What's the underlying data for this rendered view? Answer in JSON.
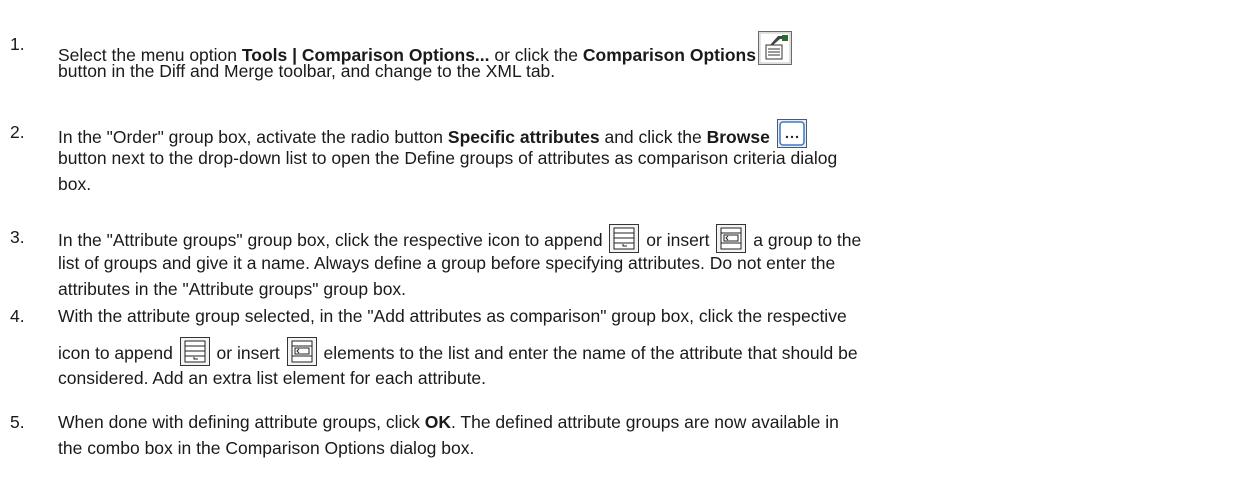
{
  "steps": [
    {
      "number": "1.",
      "l1_a": "Select the menu option ",
      "l1_b": "Tools | Comparison Options...",
      "l1_c": " or click the ",
      "l1_d": "Comparison Options",
      "l2": " button in the Diff and Merge toolbar, and change to the XML tab.",
      "icon": "comparison-options-icon"
    },
    {
      "number": "2.",
      "l1_a": "In the \"Order\" group box, activate the radio button ",
      "l1_b": "Specific attributes",
      "l1_c": " and click the ",
      "l1_d": "Browse",
      "l2": "button next to the drop-down list to open the Define groups of attributes as comparison criteria dialog",
      "l3": "box.",
      "icon": "browse-icon"
    },
    {
      "number": "3.",
      "l1_a": "In the \"Attribute groups\" group box, click the respective icon to append ",
      "l1_b": " or insert ",
      "l1_c": " a group to the",
      "l2": "list of groups and give it a name. Always define a group before specifying attributes. Do not enter the",
      "l3": "attributes in the \"Attribute groups\" group box.",
      "icons": [
        "append-icon",
        "insert-icon"
      ]
    },
    {
      "number": "4.",
      "l1": "With the attribute group selected, in the \"Add attributes as comparison\" group box, click the respective",
      "l2_a": "icon to append ",
      "l2_b": " or insert ",
      "l2_c": " elements to the list and enter the name of the attribute that should be",
      "l3": "considered. Add an extra list element for each attribute.",
      "icons": [
        "append-icon",
        "insert-icon"
      ]
    },
    {
      "number": "5.",
      "l1_a": "When done with defining attribute groups, click ",
      "l1_b": "OK",
      "l1_c": ". The defined attribute groups are now available in",
      "l2": "the combo box in the Comparison Options dialog box."
    }
  ]
}
